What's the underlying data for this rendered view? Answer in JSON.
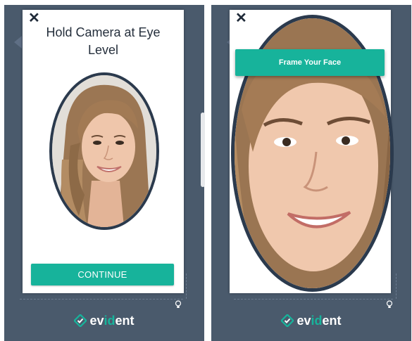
{
  "screens": [
    {
      "close_icon": "close-icon",
      "title": "Hold Camera at Eye Level",
      "continue_label": "CONTINUE",
      "face": "face-photo"
    },
    {
      "close_icon": "close-icon",
      "banner_label": "Frame Your Face",
      "face": "face-photo-zoomed"
    }
  ],
  "brand": {
    "prefix": "ev",
    "accent": "id",
    "suffix": "ent",
    "accent_color": "#17b39b"
  },
  "colors": {
    "panel_bg": "#4a5a6c",
    "button": "#17b39b",
    "oval_border": "#2b3a4d"
  }
}
